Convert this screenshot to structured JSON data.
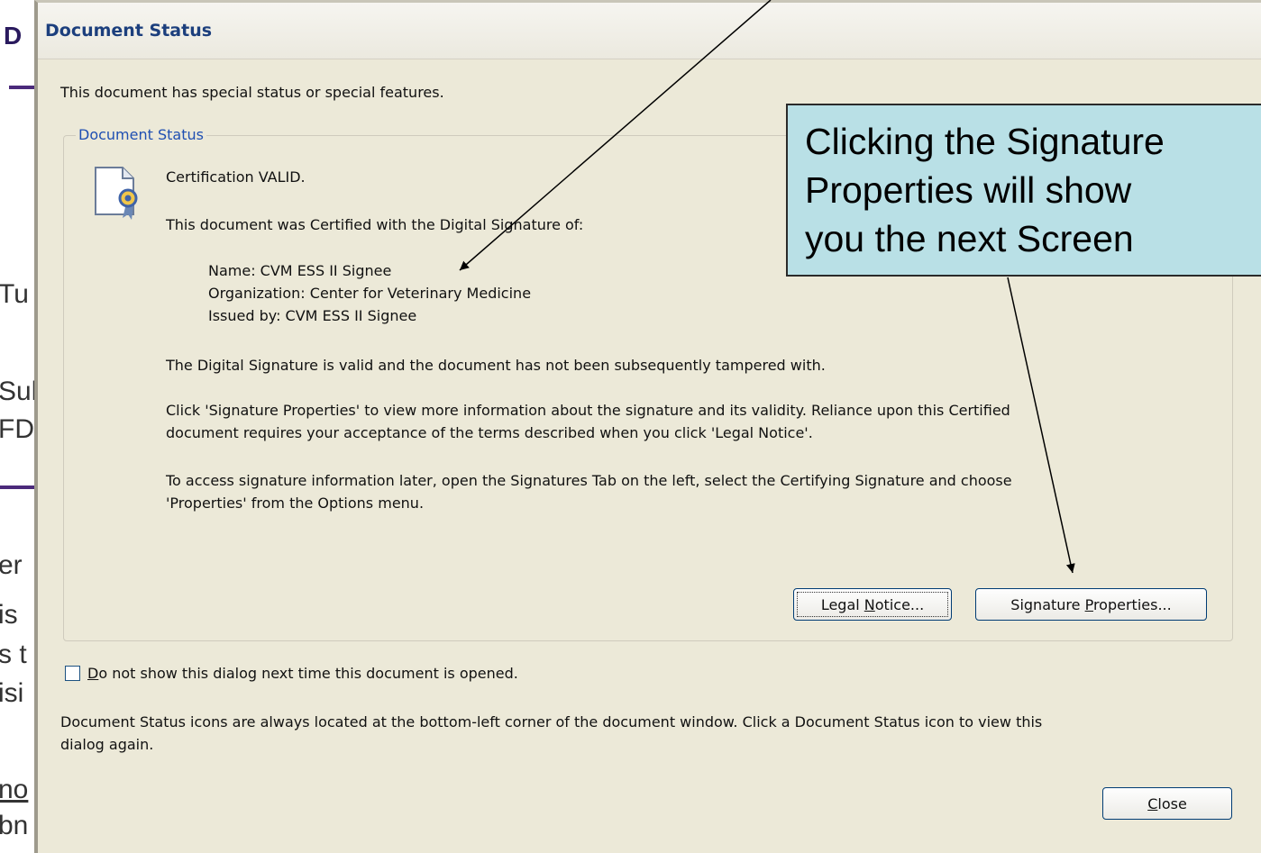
{
  "background": {
    "fragments": [
      "D",
      "Tu",
      "Sul",
      "FD",
      "er",
      "is",
      "s t",
      "isi",
      "no",
      "bn"
    ]
  },
  "dialog": {
    "title": "Document Status",
    "intro": "This document has special status or special features.",
    "group_label": "Document Status",
    "icon": "certificate-ribbon-icon",
    "status_line": "Certification VALID.",
    "certified_line": "This document was Certified with the Digital Signature of:",
    "signer": {
      "name": "Name: CVM ESS II Signee",
      "organization": "Organization: Center for Veterinary Medicine",
      "issued_by": "Issued by: CVM ESS II Signee"
    },
    "valid_line": "The Digital Signature is valid and the document has not been subsequently tampered with.",
    "click_line_1": "Click 'Signature Properties' to view more information about the signature and its validity. Reliance upon this Certified",
    "click_line_2": "document requires your acceptance of the terms described when you click 'Legal Notice'.",
    "access_line_1": "To access signature information later, open the Signatures Tab on the left, select the Certifying Signature and choose",
    "access_line_2": "'Properties' from the Options menu.",
    "buttons": {
      "legal_before": "Legal ",
      "legal_mnemonic": "N",
      "legal_after": "otice...",
      "sig_before": "Signature ",
      "sig_mnemonic": "P",
      "sig_after": "roperties...",
      "close_mnemonic": "C",
      "close_after": "lose"
    },
    "checkbox": {
      "checked": false,
      "label_mnemonic": "D",
      "label_after": "o not show this dialog next time this document is opened."
    },
    "footer_line_1": "Document Status icons are always located at the bottom-left corner of the document window. Click a Document Status icon to view this",
    "footer_line_2": "dialog again."
  },
  "callout": {
    "lines": [
      "Clicking the Signature",
      "Properties will show",
      "you the next Screen"
    ]
  },
  "colors": {
    "dialog_bg": "#ece9d8",
    "title_text": "#1c3f7d",
    "group_label": "#1f4fb2",
    "callout_bg": "#b9e0e6"
  }
}
